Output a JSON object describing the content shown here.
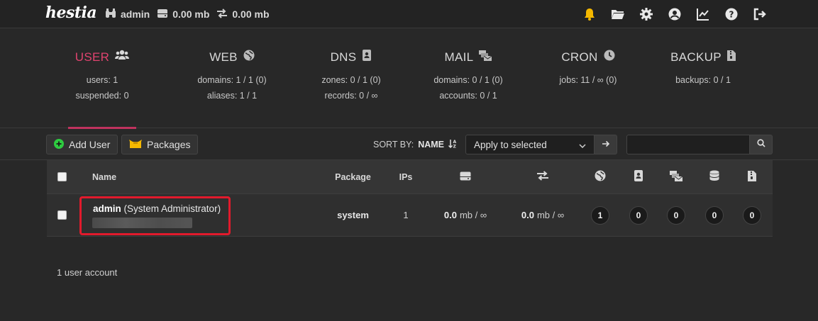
{
  "topbar": {
    "logo": "hestia",
    "user": "admin",
    "disk": "0.00 mb",
    "bandwidth": "0.00 mb",
    "icons": [
      "bell-icon",
      "folder-icon",
      "gear-icon",
      "user-circle-icon",
      "chart-icon",
      "help-icon",
      "logout-icon"
    ],
    "bell_color": "#f5b800"
  },
  "tabs": [
    {
      "title": "USER",
      "icon": "users-icon",
      "line1": "users: 1",
      "line2": "suspended: 0",
      "active": true
    },
    {
      "title": "WEB",
      "icon": "globe-icon",
      "line1": "domains: 1 / 1 (0)",
      "line2": "aliases: 1 / 1",
      "active": false
    },
    {
      "title": "DNS",
      "icon": "address-book-icon",
      "line1": "zones: 0 / 1 (0)",
      "line2": "records: 0 / ∞",
      "active": false
    },
    {
      "title": "MAIL",
      "icon": "mail-bulk-icon",
      "line1": "domains: 0 / 1 (0)",
      "line2": "accounts: 0 / 1",
      "active": false
    },
    {
      "title": "CRON",
      "icon": "clock-icon",
      "line1": "jobs: 11 / ∞ (0)",
      "line2": "",
      "active": false
    },
    {
      "title": "BACKUP",
      "icon": "file-archive-icon",
      "line1": "backups: 0 / 1",
      "line2": "",
      "active": false
    }
  ],
  "toolbar": {
    "add_user": "Add User",
    "packages": "Packages",
    "sort_by_label": "SORT BY:",
    "sort_by_value": "NAME",
    "apply_select": "Apply to selected",
    "search_placeholder": ""
  },
  "table": {
    "headers": {
      "name": "Name",
      "package": "Package",
      "ips": "IPs"
    },
    "header_icons": [
      "disk-icon",
      "bandwidth-icon",
      "globe-icon",
      "address-book-icon",
      "mail-bulk-icon",
      "database-icon",
      "file-archive-icon"
    ],
    "rows": [
      {
        "username": "admin",
        "fullname": "(System Administrator)",
        "package": "system",
        "ips": "1",
        "disk_value": "0.0",
        "disk_unit": "mb / ∞",
        "bw_value": "0.0",
        "bw_unit": "mb / ∞",
        "counts": [
          "1",
          "0",
          "0",
          "0",
          "0"
        ]
      }
    ]
  },
  "footer": {
    "count_text": "1 user account"
  },
  "colors": {
    "accent": "#e0436f",
    "highlight": "#e11a2c",
    "add_icon": "#2ecc40",
    "package_icon": "#f5b800"
  }
}
